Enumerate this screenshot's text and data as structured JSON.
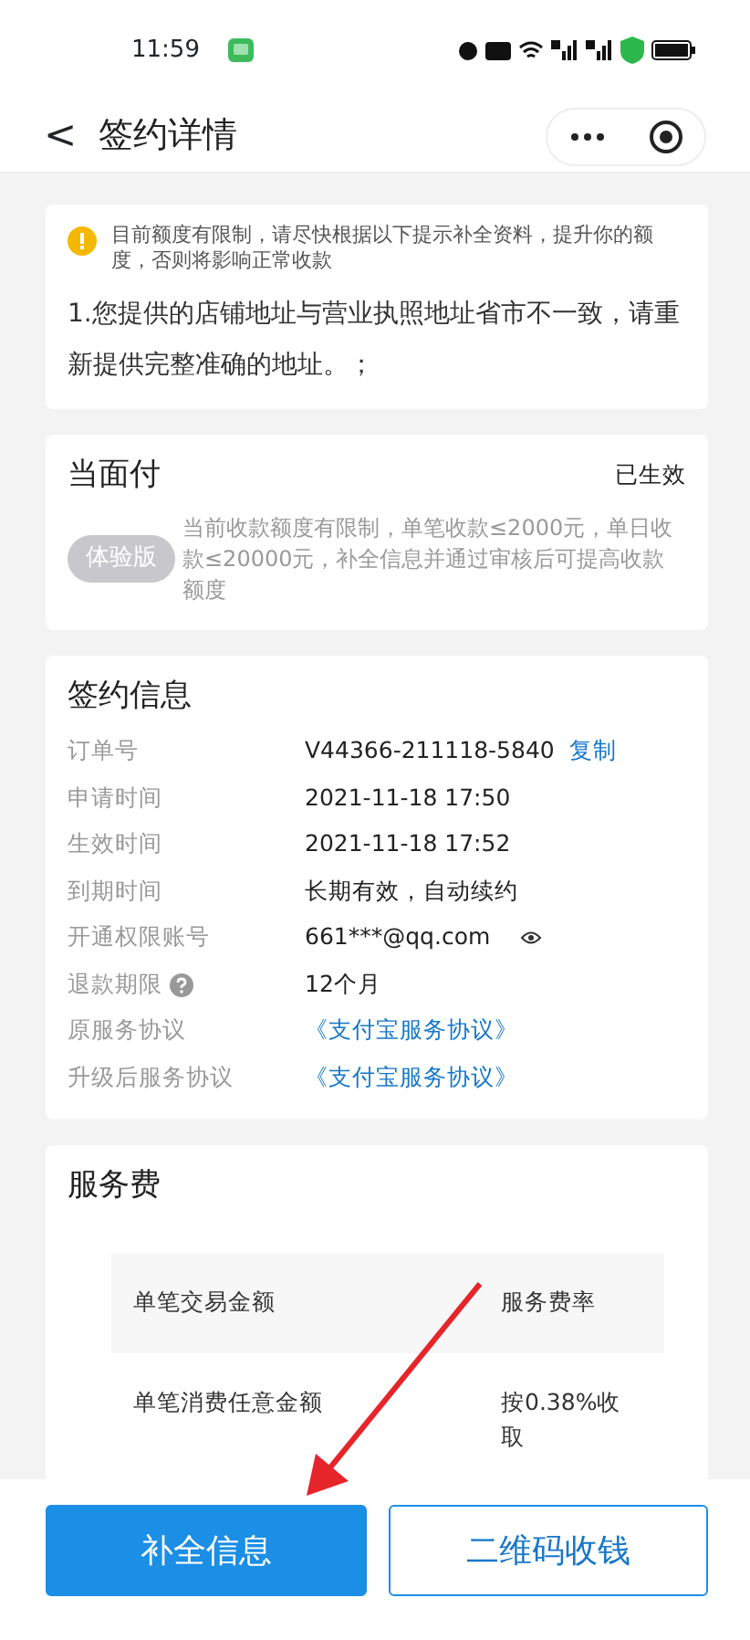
{
  "status_bar": {
    "time": "11:59"
  },
  "nav": {
    "back": "<",
    "title": "签约详情"
  },
  "notice": {
    "warning": "目前额度有限制，请尽快根据以下提示补全资料，提升你的额度，否则将影响正常收款",
    "items": [
      "1.您提供的店铺地址与营业执照地址省市不一致，请重新提供完整准确的地址。；"
    ]
  },
  "product": {
    "name": "当面付",
    "status": "已生效",
    "badge": "体验版",
    "description": "当前收款额度有限制，单笔收款≤2000元，单日收款≤20000元，补全信息并通过审核后可提高收款额度"
  },
  "contract": {
    "title": "签约信息",
    "rows": [
      {
        "label": "订单号",
        "value": "V44366-211118-5840",
        "kind": "copy",
        "action": "复制"
      },
      {
        "label": "申请时间",
        "value": "2021-11-18 17:50",
        "kind": "text"
      },
      {
        "label": "生效时间",
        "value": "2021-11-18 17:52",
        "kind": "text"
      },
      {
        "label": "到期时间",
        "value": "长期有效，自动续约",
        "kind": "text"
      },
      {
        "label": "开通权限账号",
        "value": "661***@qq.com",
        "kind": "eye"
      },
      {
        "label": "退款期限",
        "value": "12个月",
        "kind": "help"
      },
      {
        "label": "原服务协议",
        "value": "《支付宝服务协议》",
        "kind": "link"
      },
      {
        "label": "升级后服务协议",
        "value": "《支付宝服务协议》",
        "kind": "link"
      }
    ]
  },
  "fees": {
    "title": "服务费",
    "columns": [
      "单笔交易金额",
      "服务费率"
    ],
    "rows": [
      [
        "单笔消费任意金额",
        "按0.38%收取"
      ]
    ]
  },
  "buttons": [
    {
      "label": "补全信息",
      "kind": "primary"
    },
    {
      "label": "二维码收钱",
      "kind": "outline"
    }
  ]
}
